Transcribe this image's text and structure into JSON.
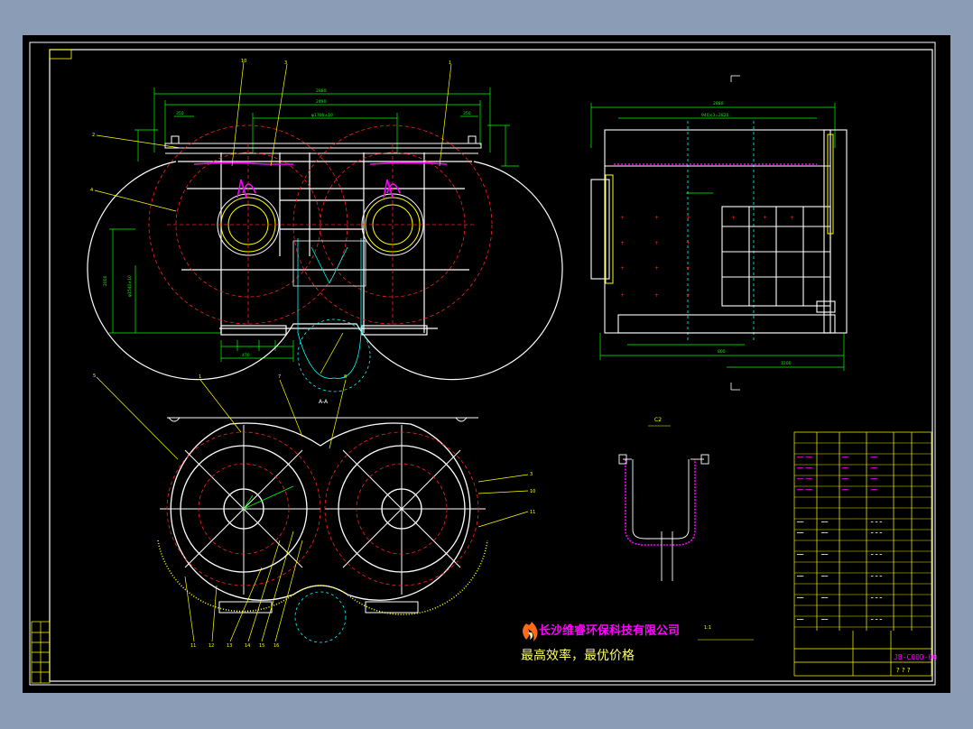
{
  "section_label": "A-A",
  "detail_label": "C2",
  "detail_label_2": "1:1",
  "company": {
    "name": "长沙维睿环保科技有限公司",
    "slogan": "最高效率，最优价格"
  },
  "colors": {
    "background": "#000000",
    "border": "#ffffff",
    "outline": "#ffffff",
    "dimension": "#00ff00",
    "hidden": "#ff2020",
    "leader": "#ffff00",
    "accent": "#ff00ff",
    "center": "#00ffff"
  },
  "title_block": {
    "drawing_no": "JB-C00D-00",
    "marks": "? ? ?"
  },
  "part_numbers": [
    "1",
    "2",
    "3",
    "4",
    "5",
    "6",
    "7",
    "8",
    "9",
    "10",
    "11",
    "12",
    "13",
    "14",
    "15",
    "16",
    "17",
    "18",
    "19",
    "20"
  ]
}
